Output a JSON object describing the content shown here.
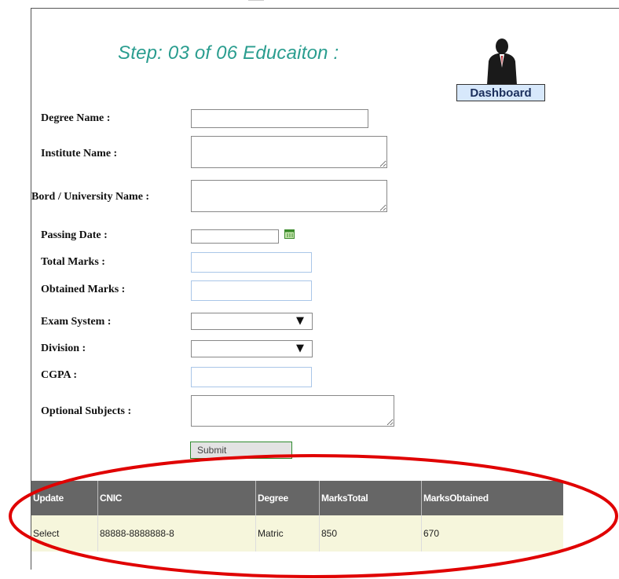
{
  "header": {
    "title": "Step: 03 of 06 Educaiton :",
    "dashboard_label": "Dashboard"
  },
  "form": {
    "degree_name_label": "Degree Name :",
    "institute_name_label": "Institute Name :",
    "board_university_label": "Bord / University Name :",
    "passing_date_label": "Passing Date :",
    "total_marks_label": "Total Marks :",
    "obtained_marks_label": "Obtained Marks :",
    "exam_system_label": "Exam System :",
    "division_label": "Division :",
    "cgpa_label": "CGPA :",
    "optional_subjects_label": "Optional Subjects :",
    "submit_label": "Submit"
  },
  "icons": {
    "avatar": "user-silhouette-icon",
    "calendar": "calendar-icon",
    "dropdown": "chevron-down-icon"
  },
  "table": {
    "headers": [
      "Update",
      "CNIC",
      "Degree",
      "MarksTotal",
      "MarksObtained"
    ],
    "rows": [
      [
        "Select",
        "88888-8888888-8",
        "Matric",
        "850",
        "670"
      ]
    ]
  },
  "colors": {
    "title": "#2a9d8f",
    "header_bg": "#666666",
    "row_bg": "#f6f6dc",
    "annotation": "#e00000"
  }
}
